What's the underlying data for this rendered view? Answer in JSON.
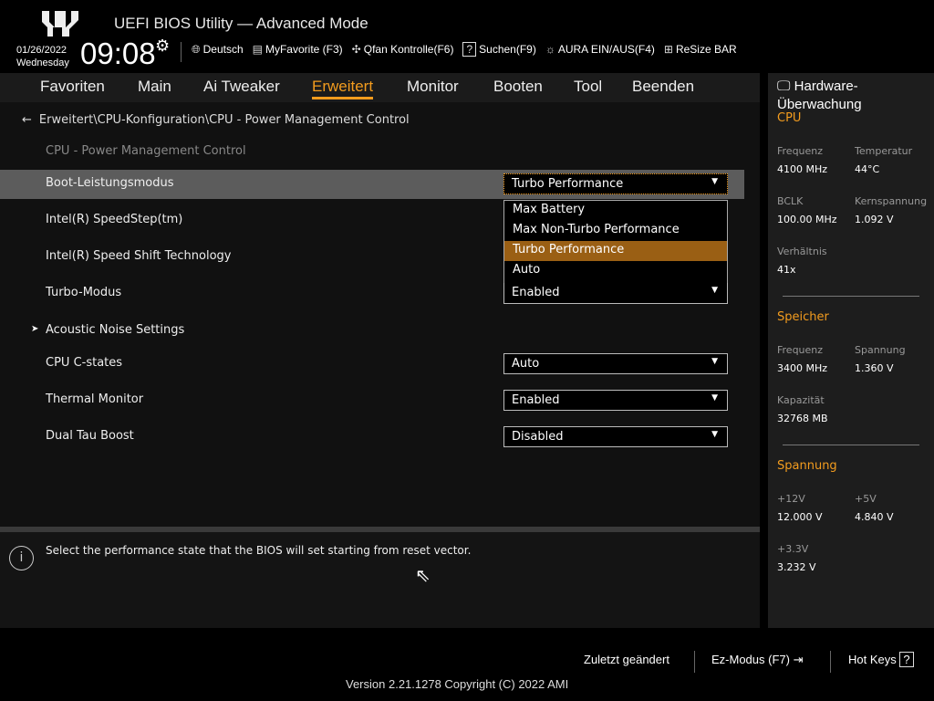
{
  "header": {
    "title": "UEFI BIOS Utility — Advanced Mode",
    "date": "01/26/2022",
    "weekday": "Wednesday",
    "time": "09:08",
    "toolbar": [
      {
        "icon": "globe-icon",
        "label": "Deutsch"
      },
      {
        "icon": "favorite-icon",
        "label": "MyFavorite (F3)"
      },
      {
        "icon": "fan-icon",
        "label": "Qfan Kontrolle(F6)"
      },
      {
        "icon": "question-icon",
        "label": "Suchen(F9)"
      },
      {
        "icon": "aura-icon",
        "label": "AURA EIN/AUS(F4)"
      },
      {
        "icon": "resize-bar-icon",
        "label": "ReSize BAR"
      }
    ]
  },
  "nav": {
    "tabs": [
      "Favoriten",
      "Main",
      "Ai Tweaker",
      "Erweitert",
      "Monitor",
      "Booten",
      "Tool",
      "Beenden"
    ],
    "active": "Erweitert"
  },
  "breadcrumb": "Erweitert\\CPU-Konfiguration\\CPU - Power Management Control",
  "section_title": "CPU - Power Management Control",
  "settings": [
    {
      "label": "Boot-Leistungsmodus",
      "value": "Turbo Performance"
    },
    {
      "label": "Intel(R) SpeedStep(tm)"
    },
    {
      "label": "Intel(R) Speed Shift Technology"
    },
    {
      "label": "Turbo-Modus",
      "value": "Enabled"
    },
    {
      "label": "Acoustic Noise Settings"
    },
    {
      "label": "CPU C-states",
      "value": "Auto"
    },
    {
      "label": "Thermal Monitor",
      "value": "Enabled"
    },
    {
      "label": "Dual Tau Boost",
      "value": "Disabled"
    }
  ],
  "dropdown_options": [
    "Max Battery",
    "Max Non-Turbo Performance",
    "Turbo Performance",
    "Auto"
  ],
  "help_text": "Select the performance state that the BIOS will set starting from reset vector.",
  "hw": {
    "title": "Hardware-Überwachung",
    "cpu": {
      "title": "CPU",
      "frequenz_label": "Frequenz",
      "frequenz": "4100 MHz",
      "temp_label": "Temperatur",
      "temp": "44°C",
      "bclk_label": "BCLK",
      "bclk": "100.00 MHz",
      "kern_label": "Kernspannung",
      "kern": "1.092 V",
      "ratio_label": "Verhältnis",
      "ratio": "41x"
    },
    "mem": {
      "title": "Speicher",
      "freq_label": "Frequenz",
      "freq": "3400 MHz",
      "volt_label": "Spannung",
      "volt": "1.360 V",
      "cap_label": "Kapazität",
      "cap": "32768 MB"
    },
    "volt": {
      "title": "Spannung",
      "v12_label": "+12V",
      "v12": "12.000 V",
      "v5_label": "+5V",
      "v5": "4.840 V",
      "v33_label": "+3.3V",
      "v33": "3.232 V"
    }
  },
  "footer": {
    "last_changed": "Zuletzt geändert",
    "ez_mode": "Ez-Modus (F7)",
    "hot_keys": "Hot Keys",
    "version": "Version 2.21.1278 Copyright (C) 2022 AMI"
  },
  "colors": {
    "accent": "#f39c1e",
    "highlight": "#9a5f14"
  }
}
